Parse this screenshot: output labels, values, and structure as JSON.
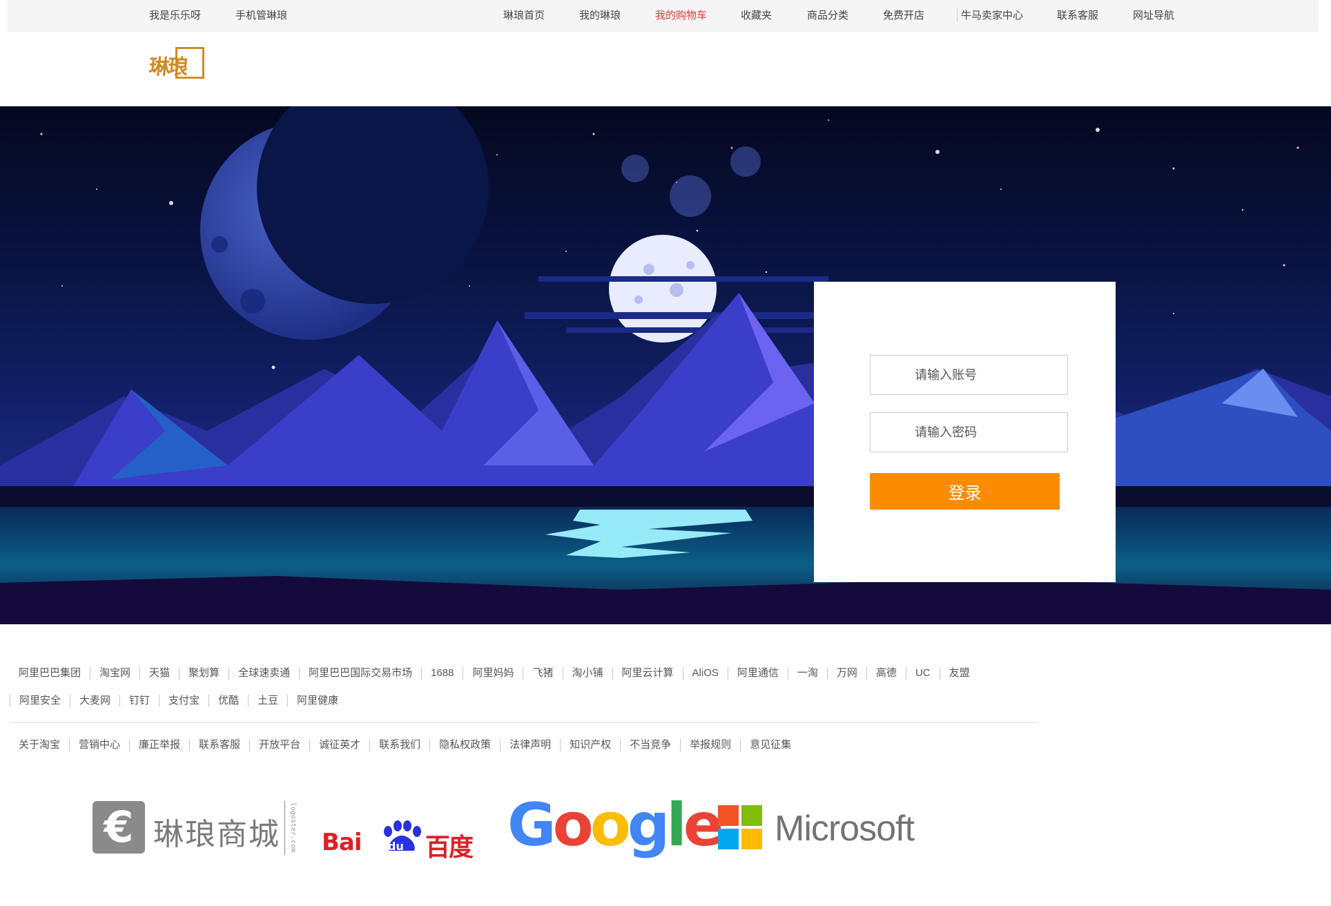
{
  "topbar": {
    "left_links": [
      "我是乐乐呀",
      "手机管琳琅"
    ],
    "right_links": [
      "琳琅首页",
      "我的琳琅",
      "我的购物车",
      "收藏夹",
      "商品分类",
      "免费开店",
      "牛马卖家中心",
      "联系客服",
      "网址导航"
    ],
    "active_color": "#e4393c"
  },
  "header": {
    "logo_text": "琳琅",
    "logo_color": "#cf8b25"
  },
  "login": {
    "account_placeholder": "请输入账号",
    "password_placeholder": "请输入密码",
    "submit_label": "登录",
    "button_color": "#fb8c00"
  },
  "footer": {
    "row1": [
      "阿里巴巴集团",
      "淘宝网",
      "天猫",
      "聚划算",
      "全球速卖通",
      "阿里巴巴国际交易市场",
      "1688",
      "阿里妈妈",
      "飞猪",
      "淘小铺",
      "阿里云计算",
      "AliOS",
      "阿里通信",
      "一淘",
      "万网",
      "高德",
      "UC",
      "友盟"
    ],
    "row2": [
      "阿里安全",
      "大麦网",
      "钉钉",
      "支付宝",
      "优酷",
      "土豆",
      "阿里健康"
    ],
    "row3": [
      "关于淘宝",
      "营销中心",
      "廉正举报",
      "联系客服",
      "开放平台",
      "诚征英才",
      "联系我们",
      "隐私权政策",
      "法律声明",
      "知识产权",
      "不当竞争",
      "举报规则",
      "意见征集"
    ]
  },
  "partners": {
    "linlang": {
      "symbol": "€",
      "name": "琳琅商城",
      "watermark": "logoster.com"
    },
    "baidu": {
      "latin": "Bai",
      "du": "du",
      "chinese": "百度"
    },
    "google": [
      "G",
      "o",
      "o",
      "g",
      "l",
      "e"
    ],
    "microsoft": {
      "name": "Microsoft",
      "colors": [
        "#f35325",
        "#81bc06",
        "#05a6f0",
        "#ffba08"
      ]
    }
  }
}
